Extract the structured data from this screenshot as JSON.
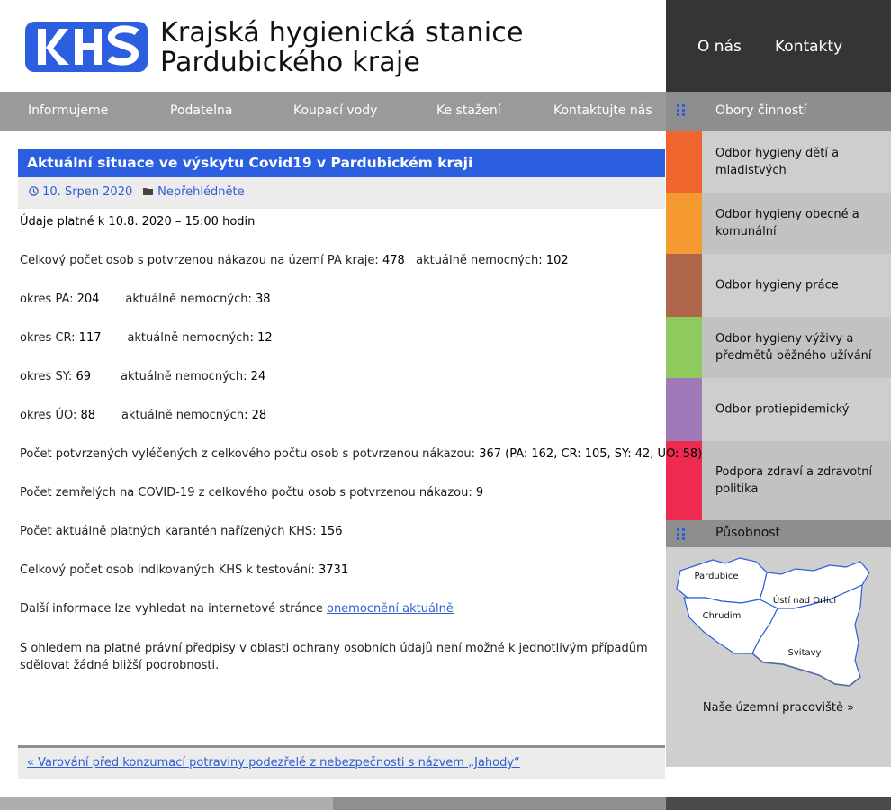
{
  "header": {
    "logo_text": "KHS",
    "title_line1": "Krajská hygienická stanice",
    "title_line2": "Pardubického kraje"
  },
  "topnav": {
    "about": "O nás",
    "contacts": "Kontakty"
  },
  "menu": [
    "Informujeme",
    "Podatelna",
    "Koupací vody",
    "Ke stažení",
    "Kontaktujte nás"
  ],
  "sidebar": {
    "activities_heading": "Obory činností",
    "categories": [
      {
        "label": "Odbor hygieny dětí a mladistvých",
        "color": "#f0652d"
      },
      {
        "label": "Odbor hygieny obecné a komunální",
        "color": "#f59a30"
      },
      {
        "label": "Odbor hygieny práce",
        "color": "#b0664a"
      },
      {
        "label": "Odbor hygieny výživy a předmětů běžného užívání",
        "color": "#8fca5e"
      },
      {
        "label": "Odbor protiepidemický",
        "color": "#a07ab8"
      },
      {
        "label": "Podpora zdraví a zdravotní politika",
        "color": "#ee2a50"
      }
    ],
    "scope_heading": "Působnost",
    "map_regions": [
      "Pardubice",
      "Ústí nad Orlicí",
      "Chrudim",
      "Svitavy"
    ],
    "map_link": "Naše územní pracoviště »"
  },
  "article": {
    "title": "Aktuální situace ve výskytu Covid19 v Pardubickém kraji",
    "date": "10. Srpen 2020",
    "category": "Nepřehlédněte",
    "valid_label": "Údaje platné k  10.8. 2020 – 15:00 hodin",
    "total_label": "Celkový počet osob s potvrzenou nákazou na území PA kraje: ",
    "total_value": "478",
    "sick_label": "aktuálně nemocných",
    "total_sick": "102",
    "districts": [
      {
        "label": "okres PA: ",
        "value": "204",
        "sick": "38"
      },
      {
        "label": "okres CR: ",
        "value": "117",
        "sick": "12"
      },
      {
        "label": "okres SY: ",
        "value": "69",
        "sick": "24"
      },
      {
        "label": "okres ÚO: ",
        "value": "88",
        "sick": "28"
      }
    ],
    "recovered_label": "Počet potvrzených vyléčených z celkového počtu osob  s potvrzenou nákazou:  ",
    "recovered_value": "367 (PA: 162, CR: 105, SY: 42, UO: 58)",
    "deaths_label": "Počet zemřelých na COVID-19 z celkového počtu osob  s potvrzenou nákazou:  ",
    "deaths_value": "9",
    "quarantine_label": "Počet aktuálně platných karantén nařízených KHS: ",
    "quarantine_value": "156",
    "tested_label": "Celkový počet osob indikovaných KHS k testování: ",
    "tested_value": "3731",
    "more_label": "Další informace lze vyhledat na internetové stránce  ",
    "more_link": "onemocnění aktuálně",
    "privacy_note": "S ohledem na platné právní předpisy v oblasti ochrany osobních údajů není možné k jednotlivým případům sdělovat žádné bližší podrobnosti."
  },
  "prev_post": "« Varování před konzumací potraviny podezřelé z nebezpečnosti s názvem „Jahody“",
  "colors": {
    "accent": "#2c5fe0",
    "link": "#2e5fd2",
    "menu": "#9a9a9a",
    "dark": "#353535"
  }
}
